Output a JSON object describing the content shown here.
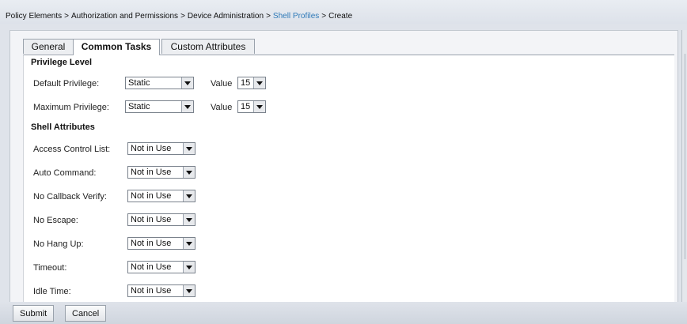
{
  "breadcrumb": {
    "items": [
      "Policy Elements",
      "Authorization and Permissions",
      "Device Administration",
      "Shell Profiles",
      "Create"
    ],
    "separator": ">"
  },
  "tabs": [
    {
      "label": "General"
    },
    {
      "label": "Common Tasks"
    },
    {
      "label": "Custom Attributes"
    }
  ],
  "privilege": {
    "title": "Privilege Level",
    "default_label": "Default Privilege:",
    "default_mode": "Static",
    "default_value_label": "Value",
    "default_value": "15",
    "maximum_label": "Maximum Privilege:",
    "maximum_mode": "Static",
    "maximum_value_label": "Value",
    "maximum_value": "15"
  },
  "shell": {
    "title": "Shell Attributes",
    "rows": [
      {
        "label": "Access Control List:",
        "value": "Not in Use"
      },
      {
        "label": "Auto Command:",
        "value": "Not in Use"
      },
      {
        "label": "No Callback Verify:",
        "value": "Not in Use"
      },
      {
        "label": "No Escape:",
        "value": "Not in Use"
      },
      {
        "label": "No Hang Up:",
        "value": "Not in Use"
      },
      {
        "label": "Timeout:",
        "value": "Not in Use"
      },
      {
        "label": "Idle Time:",
        "value": "Not in Use"
      }
    ]
  },
  "buttons": {
    "submit": "Submit",
    "cancel": "Cancel"
  },
  "colors": {
    "link": "#2f7ab8",
    "panel_bg": "#f3f4f7",
    "bar_bg": "#dfe3ea"
  }
}
